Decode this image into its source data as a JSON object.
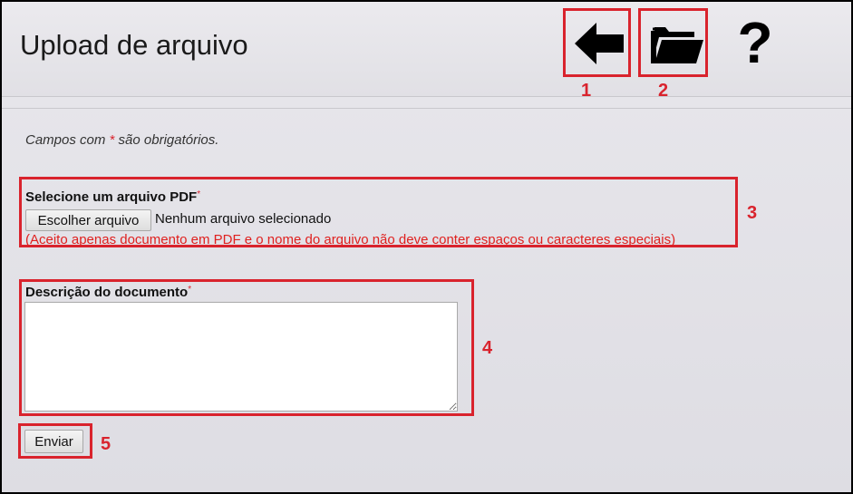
{
  "header": {
    "title": "Upload de arquivo",
    "icons": [
      "back-arrow-icon",
      "folder-open-icon",
      "help-question-icon"
    ],
    "help_glyph": "?"
  },
  "form": {
    "required_note_prefix": "Campos com ",
    "required_star": "*",
    "required_note_suffix": " são obrigatórios.",
    "file_label": "Selecione um arquivo PDF",
    "file_button": "Escolher arquivo",
    "file_status": "Nenhum arquivo selecionado",
    "file_hint": "(Aceito apenas documento em PDF e o nome do arquivo não deve conter espaços ou caracteres especiais)",
    "description_label": "Descrição do documento",
    "description_value": "",
    "submit_label": "Enviar"
  },
  "annotations": [
    "1",
    "2",
    "3",
    "4",
    "5"
  ],
  "colors": {
    "annotation_red": "#d9232d",
    "hint_red": "#e0201f",
    "background": "#e4e3e8"
  }
}
